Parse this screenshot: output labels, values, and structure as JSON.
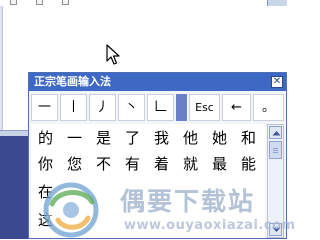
{
  "ime": {
    "title": "正宗笔画输入法",
    "close_glyph": "✕",
    "stroke_keys": [
      "一",
      "丨",
      "丿",
      "丶",
      "𠃊",
      "Esc",
      "←",
      "。"
    ],
    "candidates": [
      [
        "的",
        "一",
        "是",
        "了",
        "我",
        "他",
        "她",
        "和"
      ],
      [
        "你",
        "您",
        "不",
        "有",
        "着",
        "就",
        "最",
        "能"
      ],
      [
        "在",
        "",
        "",
        "",
        "",
        "",
        "",
        ""
      ],
      [
        "这",
        "",
        "",
        "",
        "",
        "",
        "",
        ""
      ]
    ]
  },
  "watermark": {
    "brand_cn": "偶要下载站",
    "brand_en": "www.ouyaoxiazai.com"
  },
  "icons": {
    "cursor": "mouse-pointer-icon",
    "close": "close-icon",
    "scroll_up": "arrow-up-icon",
    "scroll_down": "arrow-down-icon",
    "watermark_logo": "swirl-logo-icon"
  },
  "colors": {
    "title_bar": "#3d69c4",
    "highlight_key": "#6b80c7",
    "panel": "#f4f5f8",
    "desktop": "#3b4a8e"
  }
}
